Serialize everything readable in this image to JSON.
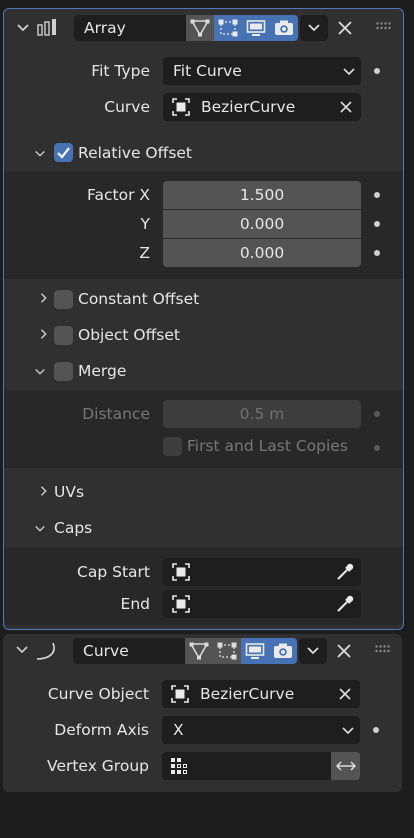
{
  "array_modifier": {
    "name": "Array",
    "fit_type_label": "Fit Type",
    "fit_type_value": "Fit Curve",
    "curve_label": "Curve",
    "curve_value": "BezierCurve",
    "relative_offset_label": "Relative Offset",
    "relative_offset_checked": true,
    "factor_x_label": "Factor X",
    "factor_x": "1.500",
    "factor_y_label": "Y",
    "factor_y": "0.000",
    "factor_z_label": "Z",
    "factor_z": "0.000",
    "constant_offset_label": "Constant Offset",
    "object_offset_label": "Object Offset",
    "merge_label": "Merge",
    "distance_label": "Distance",
    "distance_value": "0.5 m",
    "first_last_label": "First and Last Copies",
    "uvs_label": "UVs",
    "caps_label": "Caps",
    "cap_start_label": "Cap Start",
    "cap_end_label": "End"
  },
  "curve_modifier": {
    "name": "Curve",
    "curve_object_label": "Curve Object",
    "curve_object_value": "BezierCurve",
    "deform_axis_label": "Deform Axis",
    "deform_axis_value": "X",
    "vertex_group_label": "Vertex Group",
    "vertex_group_value": ""
  },
  "colors": {
    "accent": "#4772b3",
    "panel": "#303030",
    "field": "#545454",
    "dark_field": "#1e1e1e"
  }
}
